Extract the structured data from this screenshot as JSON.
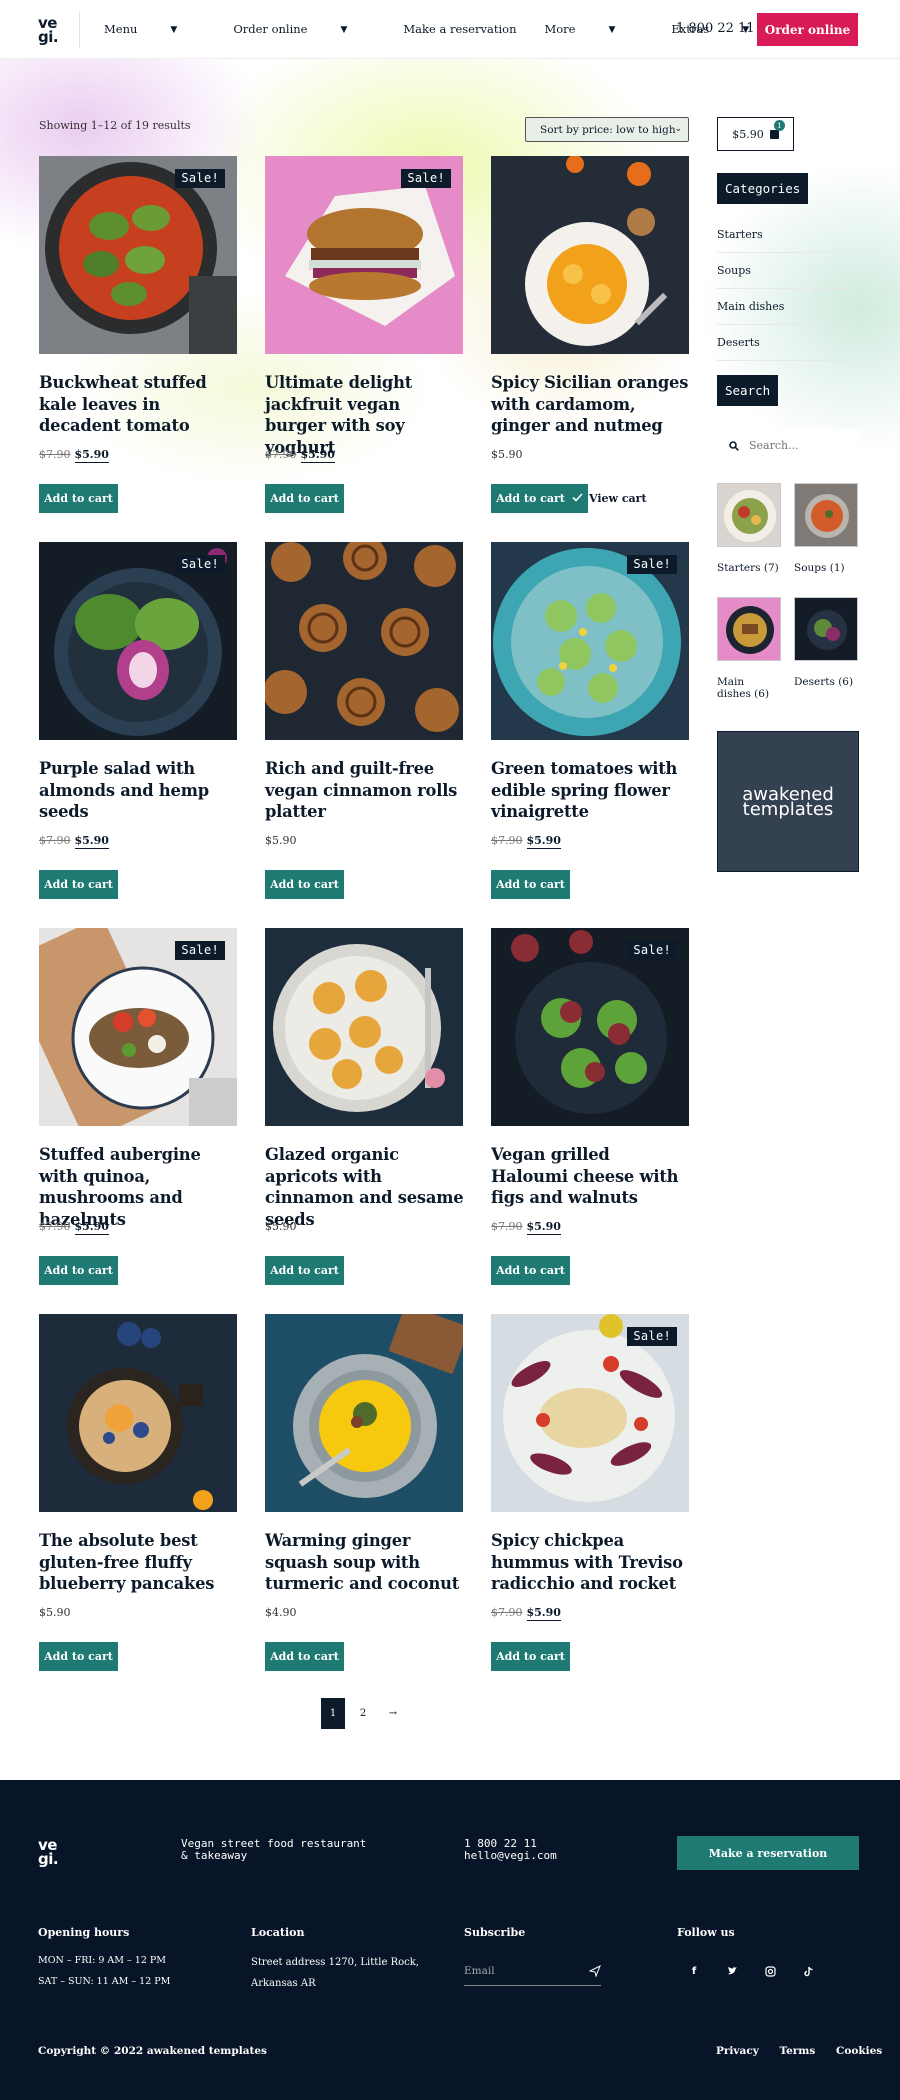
{
  "header": {
    "logo": "ve gi.",
    "logo_line1": "ve",
    "logo_line2": "gi.",
    "nav": [
      "Menu",
      "Order online",
      "Make a reservation",
      "More",
      "Extras"
    ],
    "phone": "1 800 22 11",
    "cta": "Order online"
  },
  "shop": {
    "showing": "Showing 1–12 of 19 results",
    "sort": "Sort by price: low to high",
    "sale_label": "Sale!",
    "add_label": "Add to cart",
    "view_cart": "View cart",
    "products": [
      {
        "title": "Buckwheat stuffed kale leaves in decadent tomato",
        "old": "$7.90",
        "price": "$5.90",
        "sale": true
      },
      {
        "title": "Ultimate delight jackfruit vegan burger with soy yoghurt",
        "old": "$7.90",
        "price": "$5.90",
        "sale": true
      },
      {
        "title": "Spicy Sicilian oranges with cardamom, ginger and nutmeg",
        "old": "",
        "price": "$5.90",
        "sale": false,
        "added": true
      },
      {
        "title": "Purple salad with almonds and hemp seeds",
        "old": "$7.90",
        "price": "$5.90",
        "sale": true
      },
      {
        "title": "Rich and guilt-free vegan cinnamon rolls platter",
        "old": "",
        "price": "$5.90",
        "sale": false
      },
      {
        "title": "Green tomatoes with edible spring flower vinaigrette",
        "old": "$7.90",
        "price": "$5.90",
        "sale": true
      },
      {
        "title": "Stuffed aubergine with quinoa, mushrooms and hazelnuts",
        "old": "$7.90",
        "price": "$5.90",
        "sale": true
      },
      {
        "title": "Glazed organic apricots with cinnamon and sesame seeds",
        "old": "",
        "price": "$5.90",
        "sale": false
      },
      {
        "title": "Vegan grilled Haloumi cheese with figs and walnuts",
        "old": "$7.90",
        "price": "$5.90",
        "sale": true
      },
      {
        "title": "The absolute best gluten-free fluffy blueberry pancakes",
        "old": "",
        "price": "$5.90",
        "sale": false
      },
      {
        "title": "Warming ginger squash soup with turmeric and coconut",
        "old": "",
        "price": "$4.90",
        "sale": false
      },
      {
        "title": "Spicy chickpea hummus with Treviso radicchio and rocket",
        "old": "$7.90",
        "price": "$5.90",
        "sale": true
      }
    ],
    "pagination": [
      "1",
      "2",
      "→"
    ]
  },
  "sidebar": {
    "cart_total": "$5.90",
    "cart_count": "1",
    "categories_heading": "Categories",
    "categories": [
      "Starters",
      "Soups",
      "Main dishes",
      "Deserts"
    ],
    "search_heading": "Search",
    "search_placeholder": "Search...",
    "thumb_labels": [
      "Starters (7)",
      "Soups (1)",
      "Main dishes (6)",
      "Deserts (6)"
    ],
    "promo_line1": "awakened",
    "promo_line2": "templates"
  },
  "footer": {
    "logo_line1": "ve",
    "logo_line2": "gi.",
    "tagline_1": "Vegan street food restaurant",
    "tagline_2": "& takeaway",
    "phone": "1 800 22 11",
    "email": "hello@vegi.com",
    "cta": "Make a reservation",
    "hours_heading": "Opening hours",
    "hours_1": "MON – FRI: 9 AM – 12 PM",
    "hours_2": "SAT – SUN: 11 AM – 12 PM",
    "location_heading": "Location",
    "location_1": "Street address 1270, Little Rock,",
    "location_2": "Arkansas AR",
    "subscribe_heading": "Subscribe",
    "email_placeholder": "Email",
    "follow_heading": "Follow us",
    "copyright": "Copyright © 2022 awakened templates",
    "links": [
      "Privacy",
      "Terms",
      "Cookies"
    ]
  },
  "colors": {
    "accent_red": "#d81b57",
    "accent_teal": "#1f7a73",
    "navy": "#0c1a2a"
  }
}
